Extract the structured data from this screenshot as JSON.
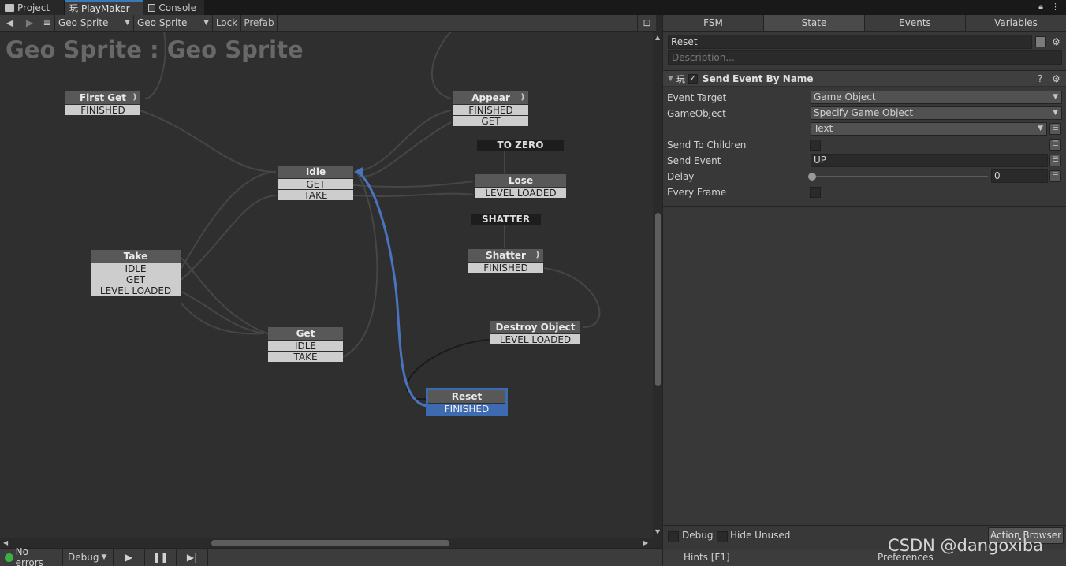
{
  "tabs": [
    {
      "label": "Project",
      "icon": "folder-icon"
    },
    {
      "label": "PlayMaker",
      "icon": "playmaker-icon"
    },
    {
      "label": "Console",
      "icon": "console-icon"
    }
  ],
  "toolbar": {
    "back": "◀",
    "forward": "▶",
    "menu": "≡",
    "gameobject": "Geo Sprite",
    "fsm": "Geo Sprite",
    "lock": "Lock",
    "prefab": "Prefab"
  },
  "canvas": {
    "title": "Geo Sprite : Geo Sprite"
  },
  "states": {
    "first_get": {
      "name": "First Get",
      "events": [
        "FINISHED"
      ]
    },
    "appear": {
      "name": "Appear",
      "events": [
        "FINISHED",
        "GET"
      ]
    },
    "idle": {
      "name": "Idle",
      "events": [
        "GET",
        "TAKE"
      ]
    },
    "lose": {
      "name": "Lose",
      "events": [
        "LEVEL LOADED"
      ]
    },
    "shatter": {
      "name": "Shatter",
      "events": [
        "FINISHED"
      ]
    },
    "take": {
      "name": "Take",
      "events": [
        "IDLE",
        "GET",
        "LEVEL LOADED"
      ]
    },
    "get": {
      "name": "Get",
      "events": [
        "IDLE",
        "TAKE"
      ]
    },
    "destroy": {
      "name": "Destroy Object",
      "events": [
        "LEVEL LOADED"
      ]
    },
    "reset": {
      "name": "Reset",
      "events": [
        "FINISHED"
      ]
    }
  },
  "global_transitions": {
    "to_zero": "TO ZERO",
    "shatter": "SHATTER"
  },
  "status": {
    "errors": "No errors",
    "debug": "Debug"
  },
  "inspector": {
    "tabs": [
      "FSM",
      "State",
      "Events",
      "Variables"
    ],
    "active_tab": "State",
    "state_name": "Reset",
    "description_placeholder": "Description...",
    "action": {
      "title": "Send Event By Name",
      "enabled": true,
      "help": "?",
      "settings": "⚙",
      "properties": {
        "event_target": {
          "label": "Event Target",
          "value": "Game Object"
        },
        "gameobject": {
          "label": "GameObject",
          "value": "Specify Game Object"
        },
        "gameobject_sub": {
          "value": "Text"
        },
        "send_to_children": {
          "label": "Send To Children",
          "checked": false
        },
        "send_event": {
          "label": "Send Event",
          "value": "UP"
        },
        "delay": {
          "label": "Delay",
          "value": "0",
          "slider_fraction": 0
        },
        "every_frame": {
          "label": "Every Frame",
          "checked": false
        }
      }
    },
    "bottom": {
      "debug": "Debug",
      "hide_unused": "Hide Unused",
      "action_browser": "Action Browser",
      "hints": "Hints [F1]",
      "preferences": "Preferences"
    }
  },
  "watermark": "CSDN @dangoxiba",
  "colors": {
    "selected_state": "#3d6bb1",
    "transition_selected": "#4a74bf",
    "ok_status": "#3bb145"
  }
}
